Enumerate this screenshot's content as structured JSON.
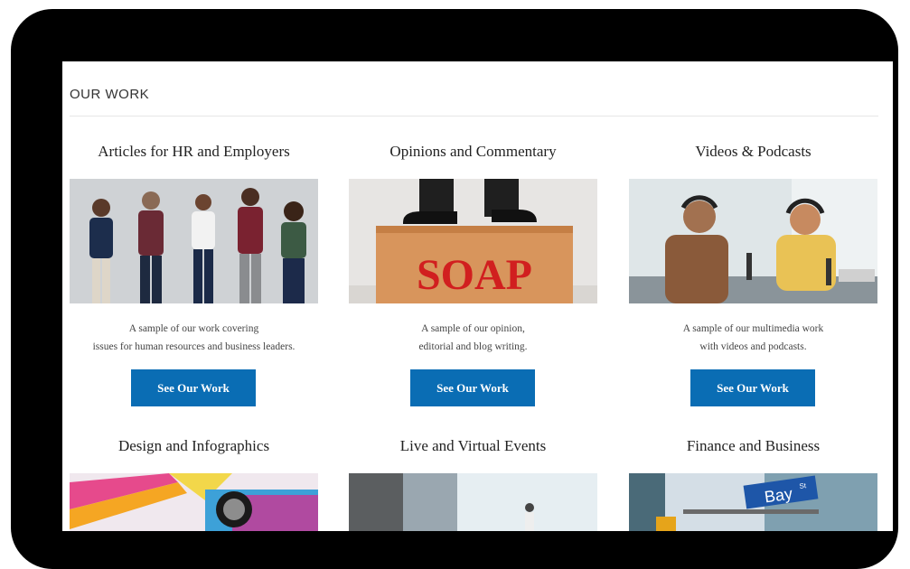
{
  "section": {
    "title": "OUR WORK"
  },
  "cards": [
    {
      "title": "Articles for HR and Employers",
      "desc_line1": "A sample of our work covering",
      "desc_line2": "issues for human resources and business leaders.",
      "button": "See Our Work"
    },
    {
      "title": "Opinions and Commentary",
      "desc_line1": "A sample of our opinion,",
      "desc_line2": "editorial and blog writing.",
      "button": "See Our Work",
      "image_text": "SOAP"
    },
    {
      "title": "Videos & Podcasts",
      "desc_line1": "A sample of our multimedia work",
      "desc_line2": "with videos and podcasts.",
      "button": "See Our Work"
    }
  ],
  "row2": [
    {
      "title": "Design and Infographics"
    },
    {
      "title": "Live and Virtual Events"
    },
    {
      "title": "Finance and Business",
      "sign_text": "Bay",
      "sign_suffix": "St"
    }
  ],
  "colors": {
    "button": "#0a6db4",
    "device": "#000000"
  }
}
